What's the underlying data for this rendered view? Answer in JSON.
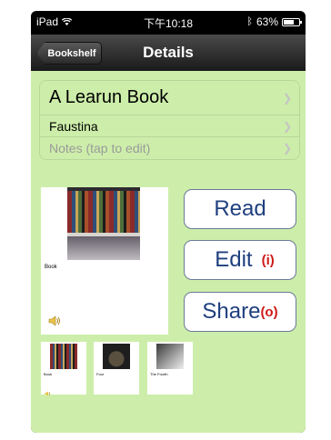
{
  "status_bar": {
    "device": "iPad",
    "time": "下午10:18",
    "battery": "63%"
  },
  "nav": {
    "back_label": "Bookshelf",
    "title": "Details"
  },
  "details": {
    "book_title": "A  Learun Book",
    "author": "Faustina",
    "notes_placeholder": "Notes  (tap to edit)"
  },
  "cover": {
    "label": "Book"
  },
  "actions": {
    "read_label": "Read",
    "edit_label": "Edit",
    "edit_hint": "(i)",
    "share_label": "Share",
    "share_hint": "(o)"
  },
  "pages": [
    {
      "label": "Book"
    },
    {
      "label": "Four"
    },
    {
      "label": "The Fourth"
    }
  ],
  "colors": {
    "background": "#cdeeaa",
    "button_text": "#1f3f7f",
    "hint": "#d01818"
  }
}
